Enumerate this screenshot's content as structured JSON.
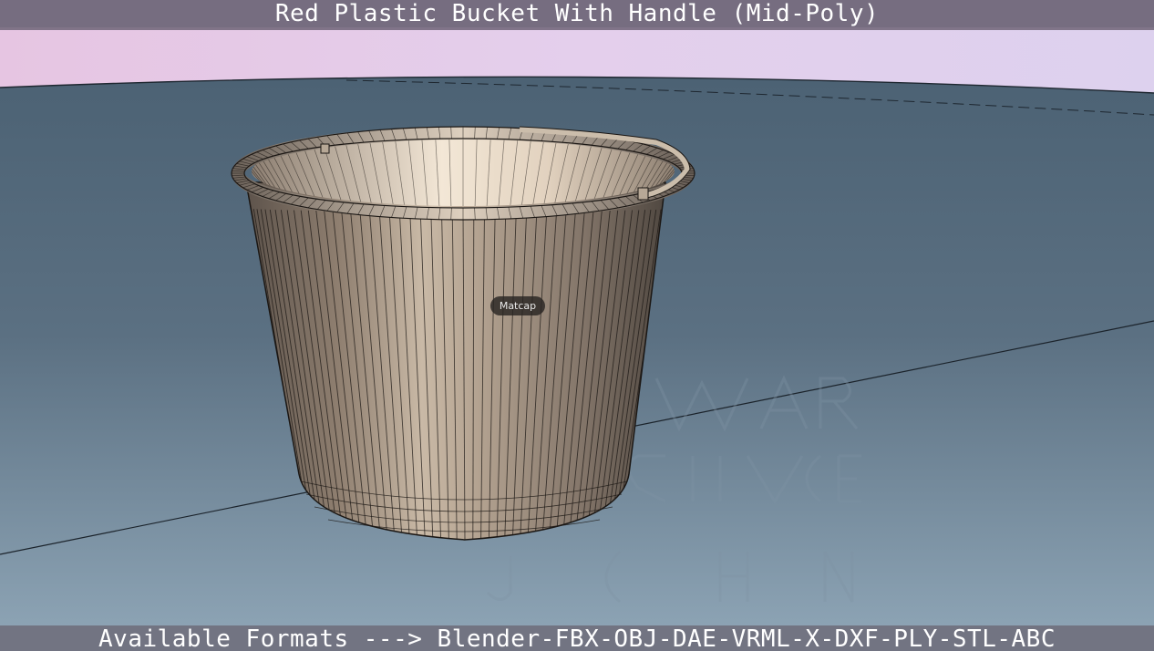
{
  "header": {
    "title": "Red Plastic Bucket With Handle (Mid-Poly)"
  },
  "viewport": {
    "shading_mode": "Matcap",
    "object": "bucket",
    "colors": {
      "sky": "#e6cde8",
      "ground": "#5c7282",
      "mesh": "#9a8878",
      "wire": "#1b1714"
    }
  },
  "footer": {
    "formats_text": "Available Formats ---> Blender-FBX-OBJ-DAE-VRML-X-DXF-PLY-STL-ABC"
  }
}
